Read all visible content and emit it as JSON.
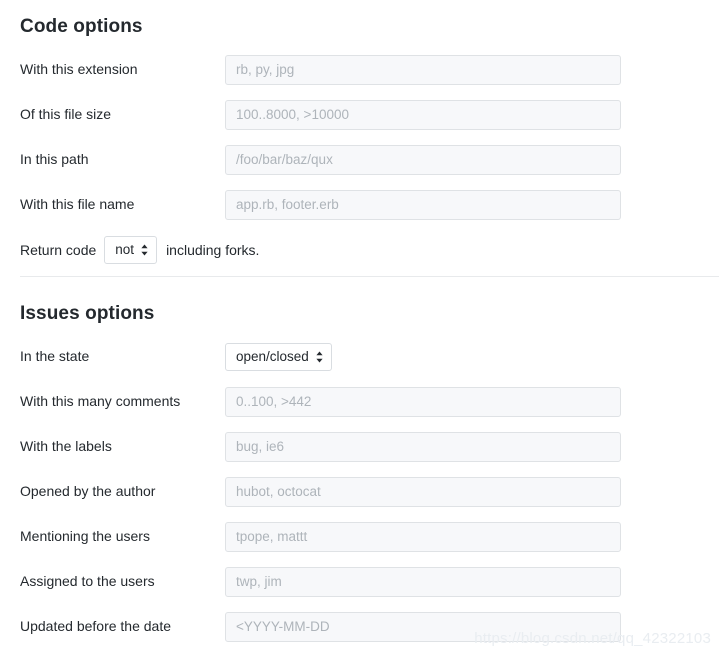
{
  "code_section": {
    "title": "Code options",
    "rows": [
      {
        "type": "input",
        "label": "With this extension",
        "placeholder": "rb, py, jpg",
        "value": ""
      },
      {
        "type": "input",
        "label": "Of this file size",
        "placeholder": "100..8000, >10000",
        "value": ""
      },
      {
        "type": "input",
        "label": "In this path",
        "placeholder": "/foo/bar/baz/qux",
        "value": ""
      },
      {
        "type": "input",
        "label": "With this file name",
        "placeholder": "app.rb, footer.erb",
        "value": ""
      }
    ],
    "return_code_row": {
      "pre_text": "Return code",
      "select_value": "not",
      "select_options": [
        "not",
        "including"
      ],
      "post_text": "including forks."
    }
  },
  "issues_section": {
    "title": "Issues options",
    "state_row": {
      "label": "In the state",
      "select_value": "open/closed",
      "select_options": [
        "open/closed",
        "open",
        "closed"
      ]
    },
    "rows": [
      {
        "type": "input",
        "label": "With this many comments",
        "placeholder": "0..100, >442",
        "value": ""
      },
      {
        "type": "input",
        "label": "With the labels",
        "placeholder": "bug, ie6",
        "value": ""
      },
      {
        "type": "input",
        "label": "Opened by the author",
        "placeholder": "hubot, octocat",
        "value": ""
      },
      {
        "type": "input",
        "label": "Mentioning the users",
        "placeholder": "tpope, mattt",
        "value": ""
      },
      {
        "type": "input",
        "label": "Assigned to the users",
        "placeholder": "twp, jim",
        "value": ""
      },
      {
        "type": "input",
        "label": "Updated before the date",
        "placeholder": "<YYYY-MM-DD",
        "value": ""
      }
    ]
  },
  "watermark": {
    "text": "https://blog.csdn.net/qq_42322103"
  },
  "colors": {
    "text": "#24292e",
    "input_bg": "#f7f8fa",
    "input_border": "#dfe2e5",
    "placeholder": "#aeb4ba",
    "divider": "#e8eaec",
    "page_bg": "#ffffff"
  }
}
